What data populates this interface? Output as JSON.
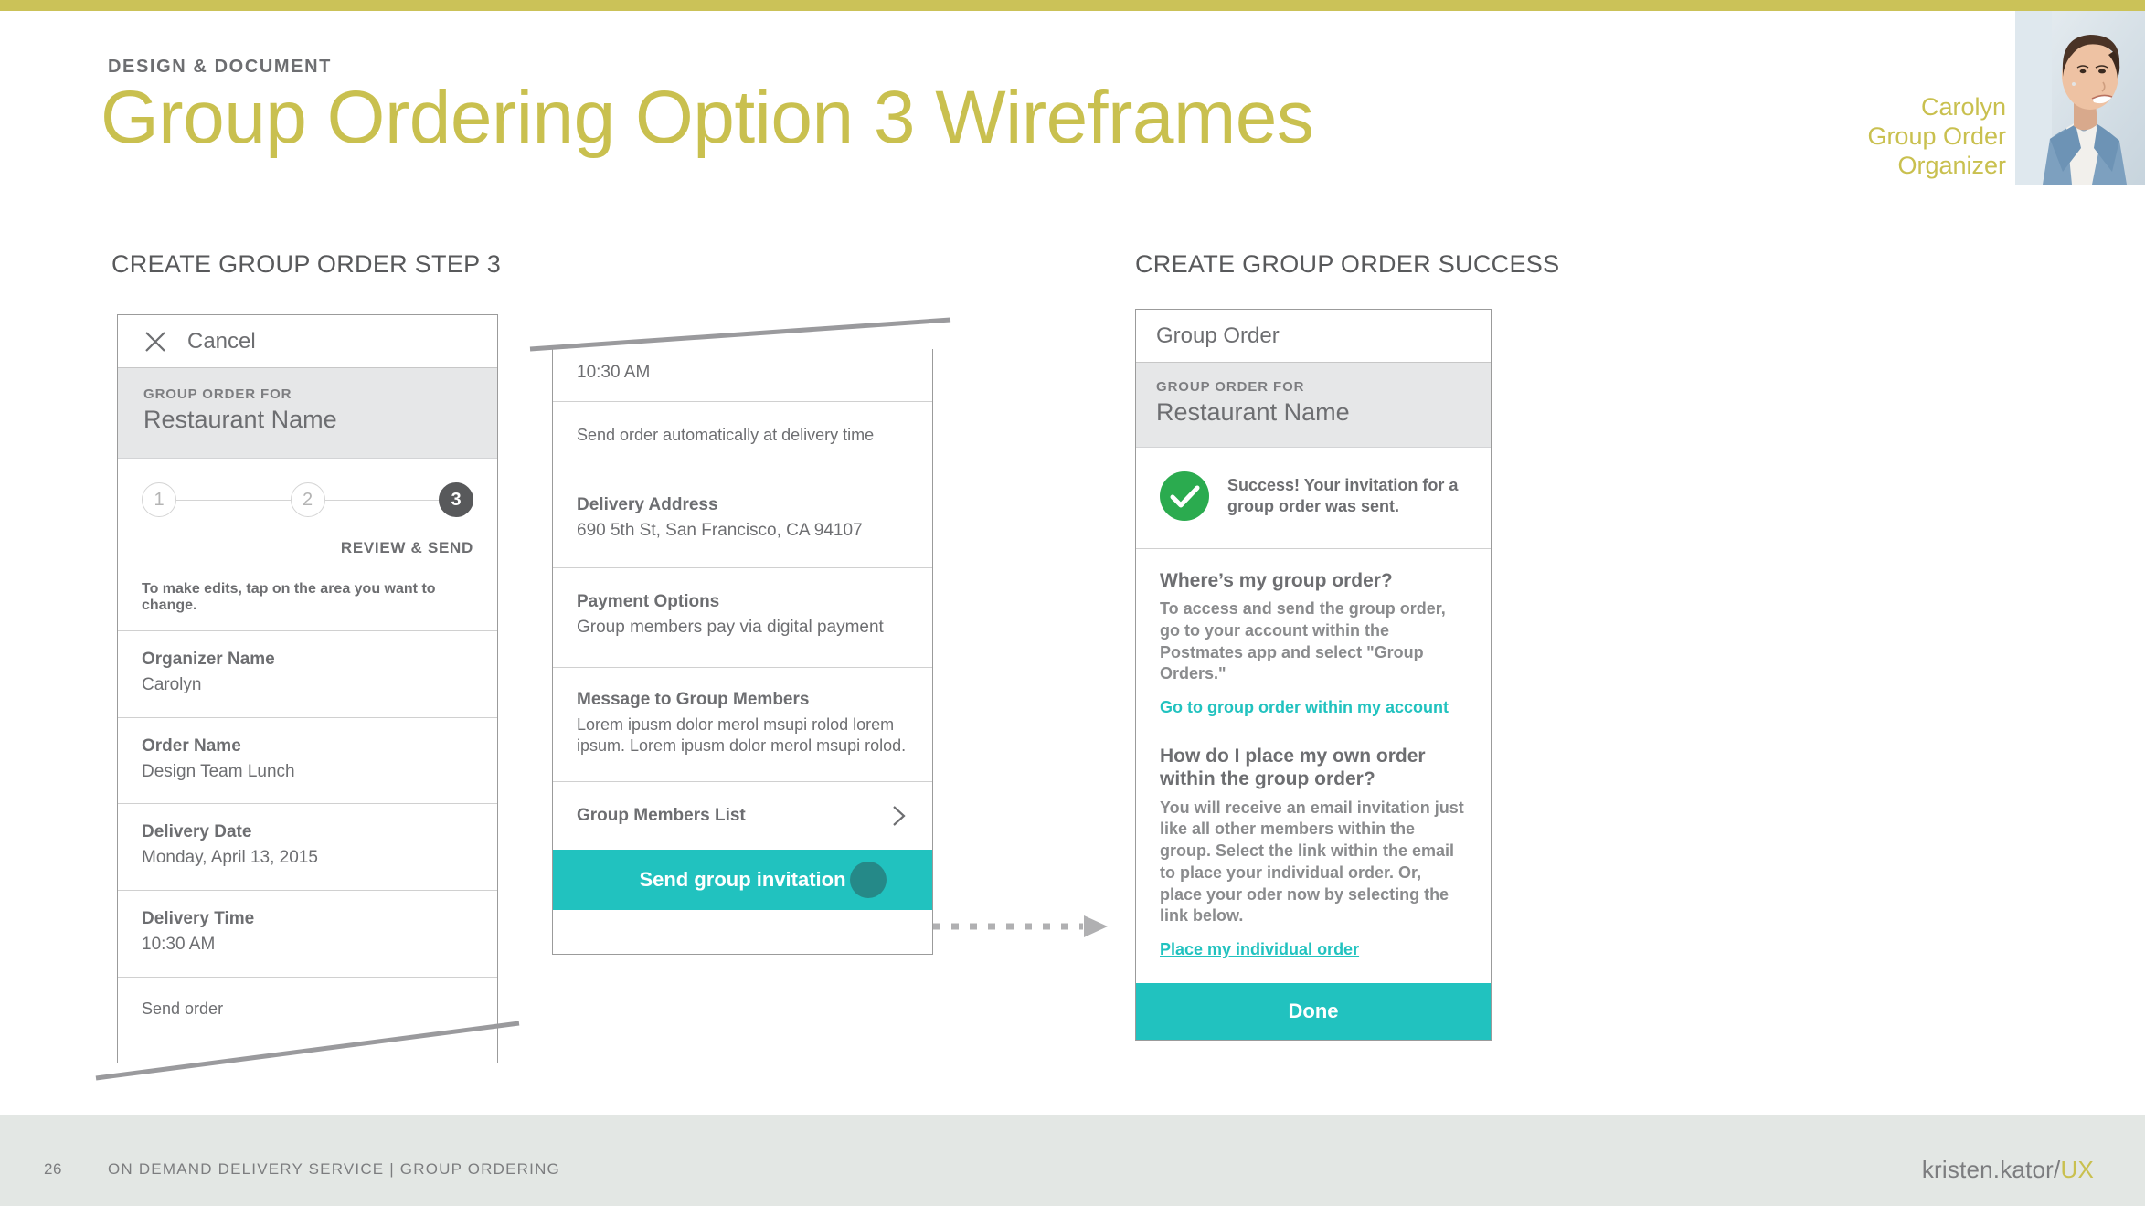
{
  "slide": {
    "eyebrow": "DESIGN & DOCUMENT",
    "title": "Group Ordering Option 3 Wireframes",
    "accent_color": "#c9c04f",
    "top_bar_color": "#cbc258"
  },
  "persona": {
    "name": "Carolyn",
    "role_line1": "Group Order",
    "role_line2": "Organizer"
  },
  "sections": {
    "left_caption": "CREATE GROUP ORDER STEP 3",
    "right_caption": "CREATE GROUP ORDER SUCCESS"
  },
  "step3_screen": {
    "nav": {
      "cancel_label": "Cancel",
      "close_icon": "close-x-icon"
    },
    "order_band": {
      "kicker": "GROUP ORDER FOR",
      "restaurant": "Restaurant Name"
    },
    "stepper": {
      "steps": [
        "1",
        "2",
        "3"
      ],
      "active_index": 2,
      "active_label": "REVIEW & SEND"
    },
    "hint": "To make edits, tap on the area you want to change.",
    "fields": [
      {
        "label": "Organizer Name",
        "value": "Carolyn"
      },
      {
        "label": "Order Name",
        "value": "Design Team Lunch"
      },
      {
        "label": "Delivery Date",
        "value": "Monday, April 13, 2015"
      },
      {
        "label": "Delivery Time",
        "value": "10:30 AM"
      }
    ],
    "truncated_row": "Send order"
  },
  "step3_detail": {
    "time_value": "10:30 AM",
    "auto_send": "Send order automatically at delivery time",
    "fields": [
      {
        "label": "Delivery Address",
        "value": "690 5th St, San Francisco, CA 94107"
      },
      {
        "label": "Payment Options",
        "value": "Group members pay via digital payment"
      },
      {
        "label": "Message to Group Members",
        "value": "Lorem ipusm dolor merol msupi rolod lorem ipsum. Lorem ipusm dolor merol msupi rolod."
      }
    ],
    "members_row": {
      "label": "Group Members List",
      "icon": "chevron-right-icon"
    },
    "cta": {
      "label": "Send group invitation",
      "color": "#21c2bf"
    }
  },
  "success_screen": {
    "nav_title": "Group Order",
    "order_band": {
      "kicker": "GROUP ORDER FOR",
      "restaurant": "Restaurant Name"
    },
    "success": {
      "icon": "check-circle-icon",
      "icon_color": "#2bab4f",
      "message": "Success! Your invitation for a group order was sent."
    },
    "faq": [
      {
        "question": "Where’s my group order?",
        "answer": "To access and send the group order, go to your account within the Postmates app and select \"Group Orders.\"",
        "link": "Go to group order within my account"
      },
      {
        "question": "How do I place my own order within the group order?",
        "answer": "You will receive an email invitation just like all other members within the group. Select the link within the email to place your individual order. Or, place your oder now by selecting the link below.",
        "link": "Place my individual order"
      }
    ],
    "done_button": "Done",
    "link_color": "#21c2bf"
  },
  "footer": {
    "page_number": "26",
    "label": "ON DEMAND DELIVERY SERVICE | GROUP ORDERING",
    "logo_main": "kristen.kator/",
    "logo_accent": "UX"
  }
}
